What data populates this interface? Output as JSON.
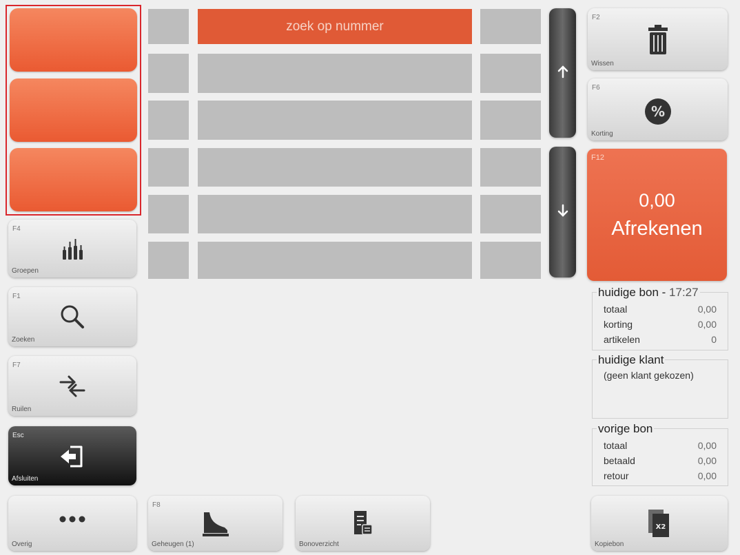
{
  "quick_buttons": [
    "",
    "",
    ""
  ],
  "left_buttons": [
    {
      "key": "F4",
      "label": "Groepen",
      "icon": "bottles-icon"
    },
    {
      "key": "F1",
      "label": "Zoeken",
      "icon": "search-icon"
    },
    {
      "key": "F7",
      "label": "Ruilen",
      "icon": "exchange-icon"
    },
    {
      "key": "Esc",
      "label": "Afsluiten",
      "icon": "exit-icon"
    },
    {
      "key": "",
      "label": "Overig",
      "icon": "more-icon"
    }
  ],
  "grid": {
    "search_label": "zoek op nummer"
  },
  "right_buttons": {
    "wissen": {
      "key": "F2",
      "label": "Wissen",
      "icon": "trash-icon"
    },
    "korting": {
      "key": "F6",
      "label": "Korting",
      "icon": "percent-icon"
    }
  },
  "pay": {
    "key": "F12",
    "amount": "0,00",
    "label": "Afrekenen"
  },
  "current_receipt": {
    "title": "huidige bon - ",
    "time": "17:27",
    "rows": [
      {
        "label": "totaal",
        "value": "0,00"
      },
      {
        "label": "korting",
        "value": "0,00"
      },
      {
        "label": "artikelen",
        "value": "0"
      }
    ]
  },
  "current_customer": {
    "title": "huidige klant",
    "note": "(geen klant gekozen)"
  },
  "previous_receipt": {
    "title": "vorige bon",
    "rows": [
      {
        "label": "totaal",
        "value": "0,00"
      },
      {
        "label": "betaald",
        "value": "0,00"
      },
      {
        "label": "retour",
        "value": "0,00"
      }
    ]
  },
  "bottom_buttons": {
    "geheugen": {
      "key": "F8",
      "label": "Geheugen (1)",
      "icon": "memory-icon"
    },
    "bonoverzicht": {
      "key": "",
      "label": "Bonoverzicht",
      "icon": "receipt-list-icon"
    },
    "kopiebon": {
      "key": "",
      "label": "Kopiebon",
      "icon": "copy-receipt-icon"
    }
  }
}
